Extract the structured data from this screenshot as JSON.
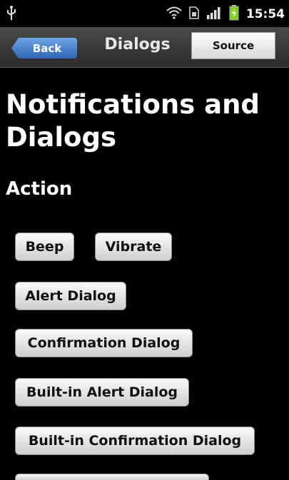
{
  "status_bar": {
    "time": "15:54",
    "icons": [
      "usb-icon",
      "wifi-icon",
      "sim-icon",
      "signal-icon",
      "battery-charging-icon"
    ]
  },
  "navbar": {
    "back_label": "Back",
    "title": "Dialogs",
    "source_label": "Source"
  },
  "content": {
    "heading": "Notifications and Dialogs",
    "section_title": "Action",
    "buttons": {
      "beep": "Beep",
      "vibrate": "Vibrate",
      "alert_dialog": "Alert Dialog",
      "confirmation_dialog": "Confirmation Dialog",
      "builtin_alert_dialog": "Built-in Alert Dialog",
      "builtin_confirmation_dialog": "Built-in Confirmation Dialog"
    }
  },
  "colors": {
    "background": "#000000",
    "back_button": "#4a86d6",
    "button_face": "#e6e6e6",
    "battery": "#7ed321"
  }
}
